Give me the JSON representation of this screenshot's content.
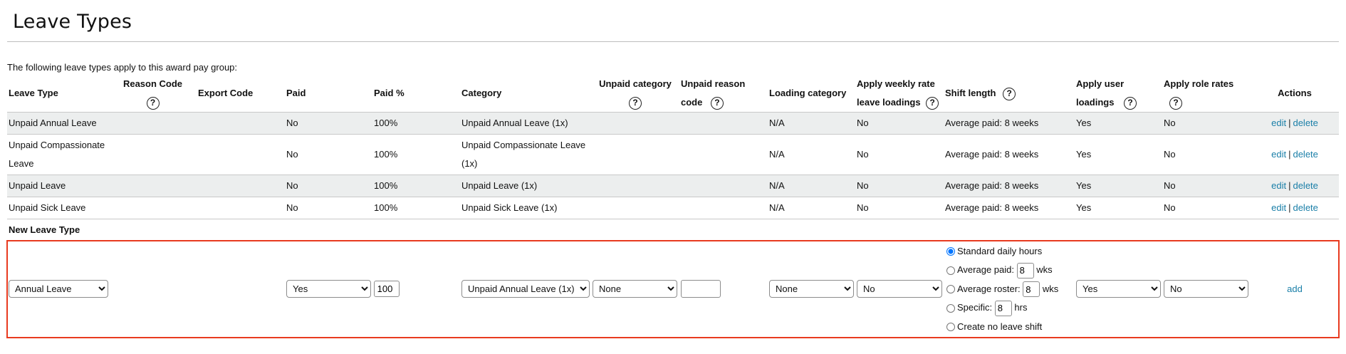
{
  "page": {
    "title": "Leave Types",
    "intro": "The following leave types apply to this award pay group:"
  },
  "columns": {
    "leave_type": "Leave Type",
    "reason_code": "Reason Code",
    "export_code": "Export Code",
    "paid": "Paid",
    "paid_pct": "Paid %",
    "category": "Category",
    "unpaid_category": "Unpaid category",
    "unpaid_reason_code_1": "Unpaid reason",
    "unpaid_reason_code_2": "code",
    "loading_category": "Loading category",
    "apply_weekly_1": "Apply weekly rate",
    "apply_weekly_2": "leave loadings",
    "shift_length": "Shift length",
    "apply_user_1": "Apply user",
    "apply_user_2": "loadings",
    "apply_role": "Apply role rates",
    "actions": "Actions"
  },
  "help_glyph": "?",
  "rows": [
    {
      "leave_type": "Unpaid Annual Leave",
      "paid": "No",
      "paid_pct": "100%",
      "category": "Unpaid Annual Leave (1x)",
      "loading": "N/A",
      "weekly": "No",
      "shift": "Average paid: 8 weeks",
      "user": "Yes",
      "role": "No",
      "edit": "edit",
      "delete": "delete"
    },
    {
      "leave_type": "Unpaid Compassionate Leave",
      "paid": "No",
      "paid_pct": "100%",
      "category": "Unpaid Compassionate Leave (1x)",
      "loading": "N/A",
      "weekly": "No",
      "shift": "Average paid: 8 weeks",
      "user": "Yes",
      "role": "No",
      "edit": "edit",
      "delete": "delete"
    },
    {
      "leave_type": "Unpaid Leave",
      "paid": "No",
      "paid_pct": "100%",
      "category": "Unpaid Leave (1x)",
      "loading": "N/A",
      "weekly": "No",
      "shift": "Average paid: 8 weeks",
      "user": "Yes",
      "role": "No",
      "edit": "edit",
      "delete": "delete"
    },
    {
      "leave_type": "Unpaid Sick Leave",
      "paid": "No",
      "paid_pct": "100%",
      "category": "Unpaid Sick Leave (1x)",
      "loading": "N/A",
      "weekly": "No",
      "shift": "Average paid: 8 weeks",
      "user": "Yes",
      "role": "No",
      "edit": "edit",
      "delete": "delete"
    }
  ],
  "action_separator": "|",
  "new_leave": {
    "heading": "New Leave Type",
    "leave_type": "Annual Leave",
    "paid": "Yes",
    "paid_pct": "100",
    "category": "Unpaid Annual Leave (1x)",
    "unpaid_category": "None",
    "unpaid_reason_code": "",
    "loading": "None",
    "weekly": "No",
    "shift_options": {
      "standard": "Standard daily hours",
      "avg_paid": "Average paid:",
      "avg_paid_value": "8",
      "avg_paid_unit": "wks",
      "avg_roster": "Average roster:",
      "avg_roster_value": "8",
      "avg_roster_unit": "wks",
      "specific": "Specific:",
      "specific_value": "8",
      "specific_unit": "hrs",
      "none": "Create no leave shift"
    },
    "user": "Yes",
    "role": "No",
    "add": "add"
  }
}
